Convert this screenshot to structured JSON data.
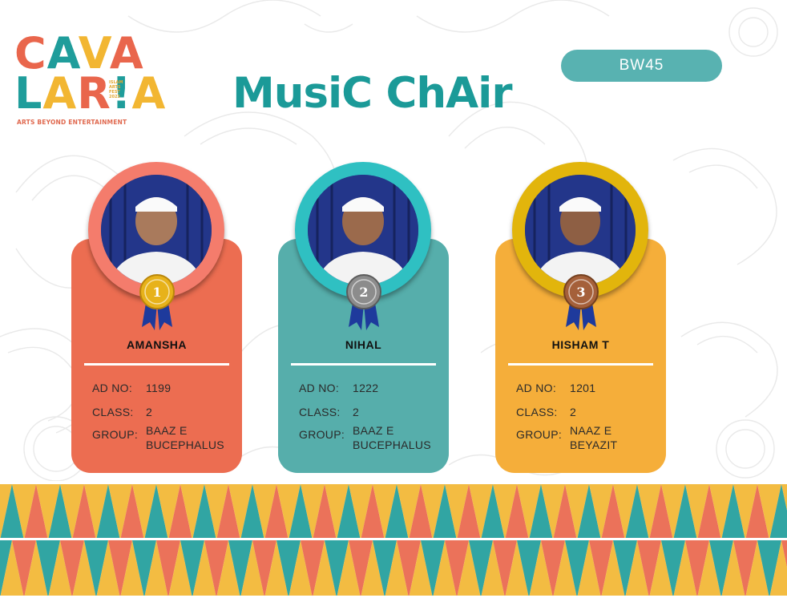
{
  "logo": {
    "line1": "CAVA",
    "line2": "LAR!A",
    "tagline": "ARTS BEYOND ENTERTAINMENT",
    "fest_text": "ISLAM\nARTS\nFEST\n2023",
    "colors": {
      "orange": "#e9664c",
      "teal": "#1f9d9b",
      "yellow": "#f2b632"
    }
  },
  "event": {
    "title": "MusiC ChAir",
    "code": "BW45"
  },
  "winners": [
    {
      "position": "1",
      "name": "AMANSHA",
      "ad_no_label": "AD NO:",
      "ad_no": "1199",
      "class_label": "CLASS:",
      "class": "2",
      "group_label": "GROUP:",
      "group_line1": "BAAZ E",
      "group_line2": "BUCEPHALUS",
      "card_color": "#ec6d51",
      "ring_color": "#f47c6c",
      "medal": "gold-medal-icon"
    },
    {
      "position": "2",
      "name": "NIHAL",
      "ad_no_label": "AD NO:",
      "ad_no": "1222",
      "class_label": "CLASS:",
      "class": "2",
      "group_label": "GROUP:",
      "group_line1": "BAAZ E",
      "group_line2": "BUCEPHALUS",
      "card_color": "#56aeab",
      "ring_color": "#2fc0c2",
      "medal": "silver-medal-icon"
    },
    {
      "position": "3",
      "name": "HISHAM T",
      "ad_no_label": "AD NO:",
      "ad_no": "1201",
      "class_label": "CLASS:",
      "class": "2",
      "group_label": "GROUP:",
      "group_line1": "NAAZ E",
      "group_line2": "BEYAZIT",
      "card_color": "#f5ae3a",
      "ring_color": "#e2b50c",
      "medal": "bronze-medal-icon"
    }
  ]
}
